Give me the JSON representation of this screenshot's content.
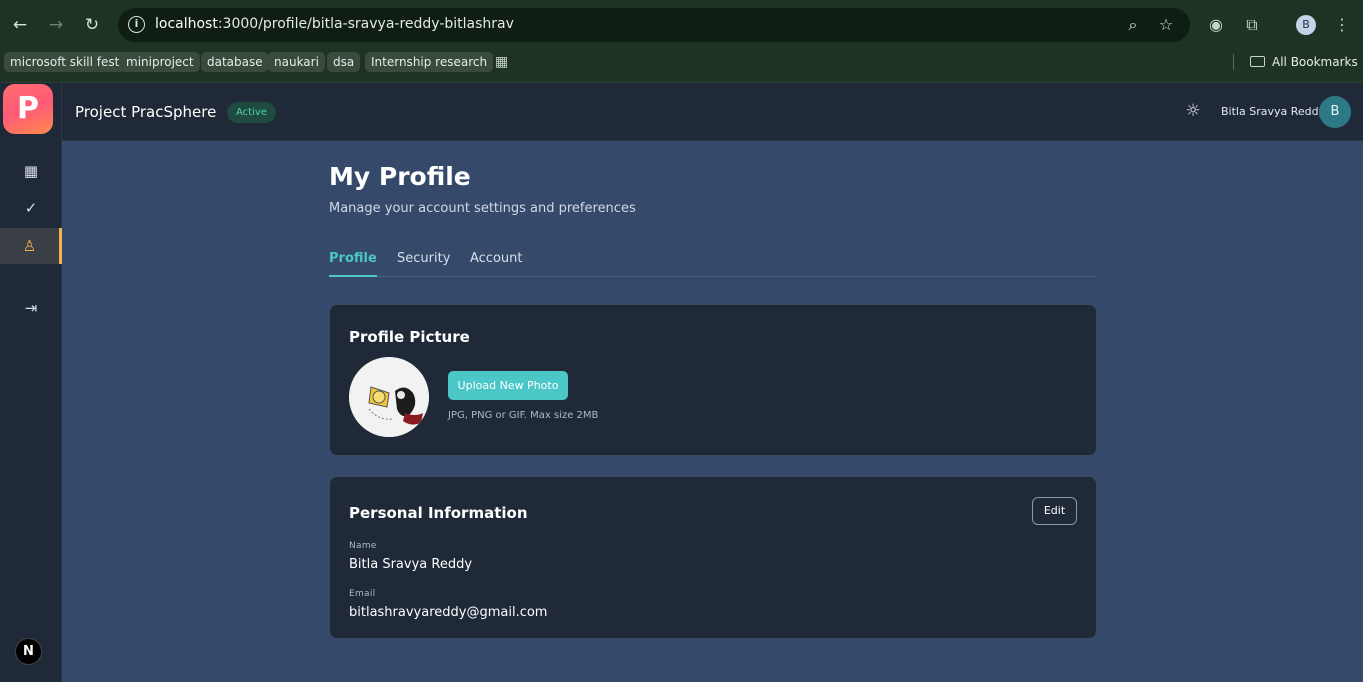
{
  "browser": {
    "url_host": "localhost",
    "url_path": ":3000/profile/bitla-sravya-reddy-bitlashrav",
    "profile_initial": "B",
    "icons": [
      "back-icon",
      "forward-icon",
      "reload-icon",
      "info-icon",
      "zoom-icon",
      "star-icon",
      "extension-icon",
      "puzzle-icon",
      "menu-icon"
    ],
    "bookmarks": [
      "microsoft skill fest",
      "miniproject",
      "database",
      "naukari",
      "dsa",
      "Internship research"
    ],
    "all_bookmarks": "All Bookmarks"
  },
  "app": {
    "logo_letter": "P",
    "project_title": "Project PracSphere",
    "status": "Active",
    "user_name": "Bitla Sravya Reddy",
    "user_initial": "B",
    "next_badge": "N",
    "accent": "#4cc7c7",
    "active_nav_color": "#f6b04c"
  },
  "page": {
    "title": "My Profile",
    "subtitle": "Manage your account settings and preferences",
    "tabs": [
      "Profile",
      "Security",
      "Account"
    ]
  },
  "picture_card": {
    "title": "Profile Picture",
    "upload_label": "Upload New Photo",
    "hint": "JPG, PNG or GIF. Max size 2MB"
  },
  "info_card": {
    "title": "Personal Information",
    "edit_label": "Edit",
    "name_label": "Name",
    "name_value": "Bitla Sravya Reddy",
    "email_label": "Email",
    "email_value": "bitlashravyareddy@gmail.com"
  }
}
